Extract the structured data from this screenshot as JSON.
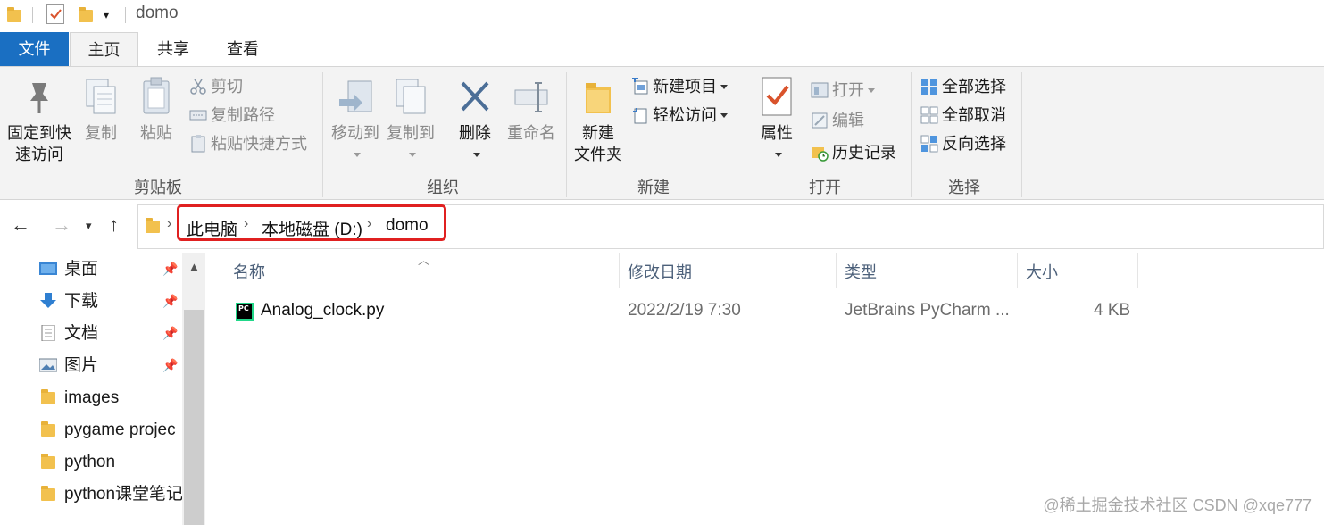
{
  "window": {
    "title": "domo"
  },
  "ribbon_tabs": [
    "文件",
    "主页",
    "共享",
    "查看"
  ],
  "clipboard": {
    "pin_label_line1": "固定到快",
    "pin_label_line2": "速访问",
    "copy": "复制",
    "paste": "粘贴",
    "cut": "剪切",
    "copy_path": "复制路径",
    "paste_shortcut": "粘贴快捷方式",
    "group": "剪贴板"
  },
  "organize": {
    "move_to": "移动到",
    "copy_to": "复制到",
    "delete": "删除",
    "rename": "重命名",
    "group": "组织"
  },
  "new": {
    "new_folder_line1": "新建",
    "new_folder_line2": "文件夹",
    "new_item": "新建项目",
    "easy_access": "轻松访问",
    "group": "新建"
  },
  "open": {
    "properties": "属性",
    "open": "打开",
    "edit": "编辑",
    "history": "历史记录",
    "group": "打开"
  },
  "select": {
    "select_all": "全部选择",
    "select_none": "全部取消",
    "invert": "反向选择",
    "group": "选择"
  },
  "address": {
    "crumbs": [
      "此电脑",
      "本地磁盘 (D:)",
      "domo"
    ]
  },
  "nav_pane": {
    "items": [
      "桌面",
      "下载",
      "文档",
      "图片",
      "images",
      "pygame projec",
      "python",
      "python课堂笔记"
    ]
  },
  "file_list": {
    "columns": [
      "名称",
      "修改日期",
      "类型",
      "大小"
    ],
    "rows": [
      {
        "name": "Analog_clock.py",
        "modified": "2022/2/19 7:30",
        "type": "JetBrains PyCharm ...",
        "size": "4 KB"
      }
    ]
  },
  "watermark": "@稀土掘金技术社区 CSDN @xqe777",
  "colors": {
    "accent": "#1a6fc2",
    "highlight_box": "#e02020",
    "folder": "#f2c14e"
  }
}
